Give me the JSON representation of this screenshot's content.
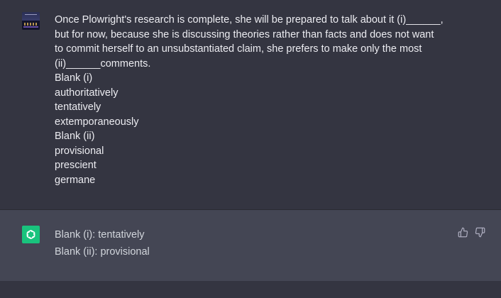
{
  "user_message": {
    "avatar": "user-avatar-image",
    "lines": [
      "Once Plowright's research is complete, she will be prepared to talk about it (i)______,",
      "but for now, because she is discussing theories rather than facts and does not want",
      "to commit herself to an unsubstantiated claim, she prefers to make only the most",
      "(ii)______comments.",
      "Blank (i)",
      "authoritatively",
      "tentatively",
      "extemporaneously",
      "Blank (ii)",
      "provisional",
      "prescient",
      "germane"
    ]
  },
  "assistant_message": {
    "avatar": "openai-logo-icon",
    "lines": [
      "Blank (i): tentatively",
      "Blank (ii): provisional"
    ]
  },
  "feedback": {
    "thumbs_up_icon": "thumbs-up-icon",
    "thumbs_down_icon": "thumbs-down-icon"
  },
  "colors": {
    "background": "#343541",
    "assistant_background": "#444654",
    "text_primary": "#ececf1",
    "text_secondary": "#d1d5db",
    "brand_green": "#19c37d",
    "icon_gray": "#acacbe"
  }
}
